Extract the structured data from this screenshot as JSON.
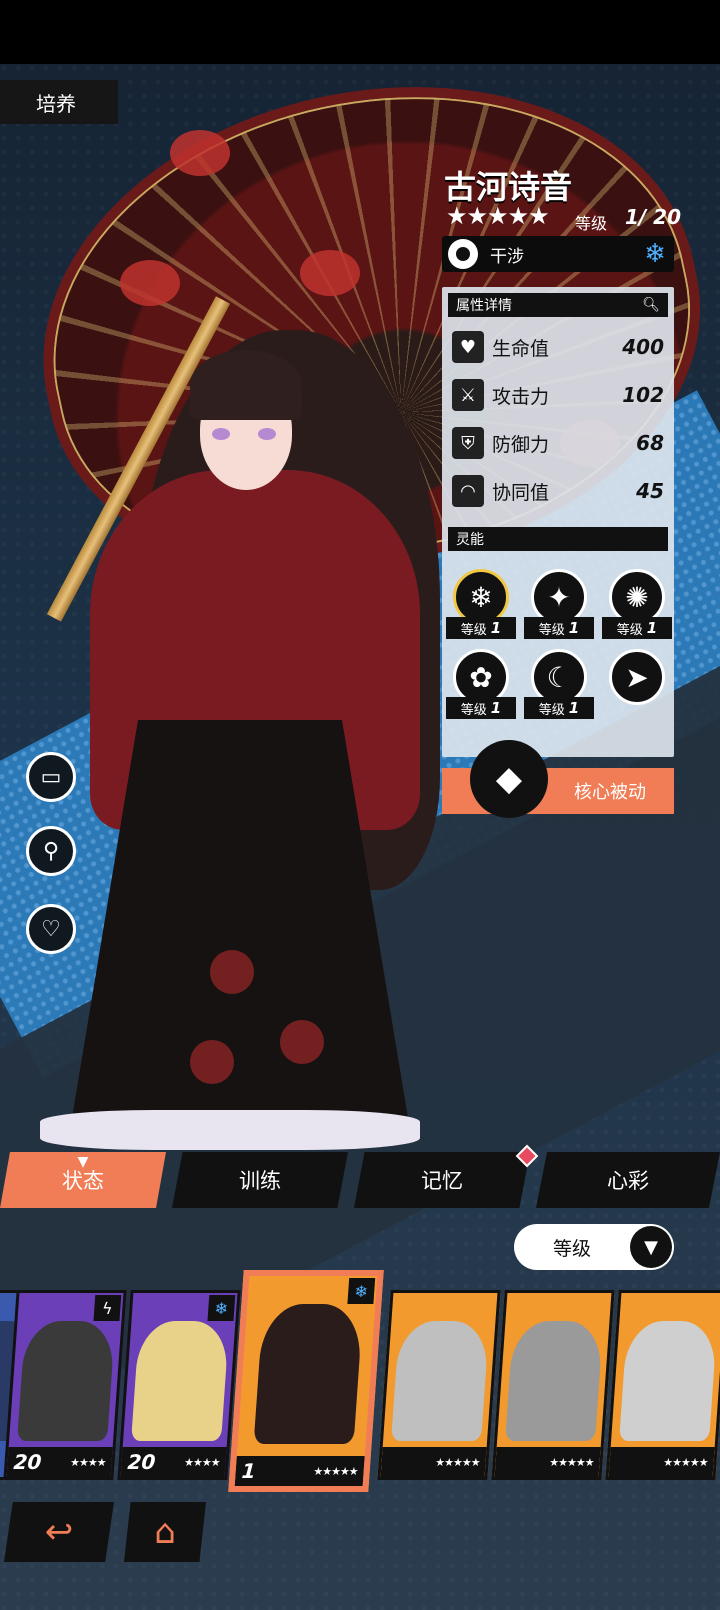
{
  "screen": {
    "tag": "培养"
  },
  "character": {
    "name": "古河诗音",
    "stars": "★★★★★",
    "level_label": "等级",
    "level_value": "1/ 20",
    "element_label": "干涉"
  },
  "attributes": {
    "header": "属性详情",
    "rows": [
      {
        "label": "生命值",
        "value": "400",
        "icon": "heart-monitor-icon"
      },
      {
        "label": "攻击力",
        "value": "102",
        "icon": "sword-icon"
      },
      {
        "label": "防御力",
        "value": "68",
        "icon": "shield-icon"
      },
      {
        "label": "协同值",
        "value": "45",
        "icon": "rainbow-arc-icon"
      }
    ]
  },
  "skills": {
    "header": "灵能",
    "items": [
      {
        "label": "等级",
        "value": "1",
        "icon": "snowflake-tree-icon"
      },
      {
        "label": "等级",
        "value": "1",
        "icon": "ice-shards-icon"
      },
      {
        "label": "等级",
        "value": "1",
        "icon": "snow-ring-icon"
      },
      {
        "label": "等级",
        "value": "1",
        "icon": "rose-icon"
      },
      {
        "label": "等级",
        "value": "1",
        "icon": "ice-crescent-icon"
      },
      {
        "label": "",
        "value": "",
        "icon": "running-figure-icon"
      }
    ],
    "core_label": "核心被动"
  },
  "tabs": [
    {
      "label": "状态",
      "active": true
    },
    {
      "label": "训练",
      "active": false
    },
    {
      "label": "记忆",
      "active": false
    },
    {
      "label": "心彩",
      "active": false
    }
  ],
  "sort": {
    "label": "等级"
  },
  "roster": [
    {
      "level": "20",
      "stars": "★★★★",
      "element": "bolt-icon",
      "color": "#6a3fb8"
    },
    {
      "level": "20",
      "stars": "★★★★",
      "element": "snowflake-icon",
      "color": "#6a3fb8"
    },
    {
      "level": "1",
      "stars": "★★★★★",
      "element": "snowflake-icon",
      "color": "#f29a2e"
    },
    {
      "level": "",
      "stars": "★★★★★",
      "element": "",
      "color": "#f29a2e"
    },
    {
      "level": "",
      "stars": "★★★★★",
      "element": "",
      "color": "#f29a2e"
    },
    {
      "level": "",
      "stars": "★★★★★",
      "element": "",
      "color": "#f29a2e"
    }
  ],
  "colors": {
    "accent": "#f07d55",
    "panel": "#dce4ec",
    "ice": "#4fb0ff"
  }
}
